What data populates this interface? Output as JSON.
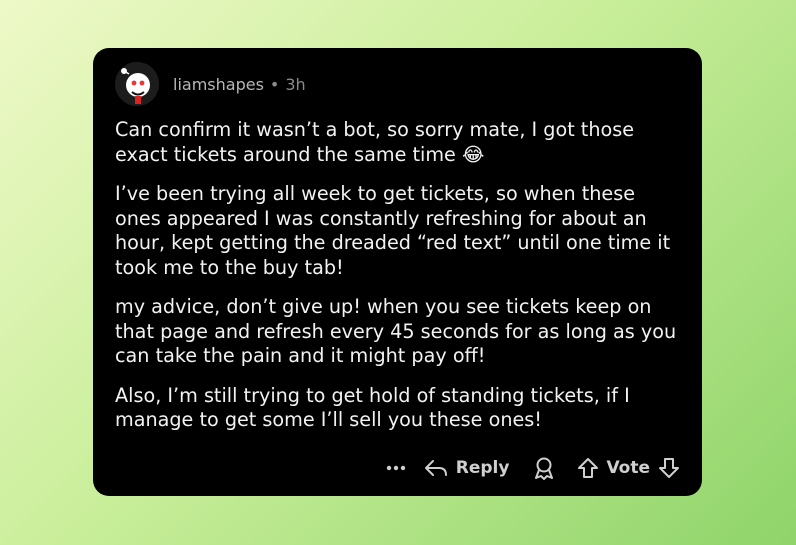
{
  "comment": {
    "username": "liamshapes",
    "separator": "•",
    "time_ago": "3h",
    "paragraphs": [
      "Can confirm it wasn’t a bot, so sorry mate, I got those exact tickets around the same time 😂",
      "I’ve been trying all week to get tickets, so when these ones appeared I was constantly refreshing for about an hour, kept getting the dreaded “red text” until one time it took me to the buy tab!",
      "my advice, don’t give up! when you see tickets keep on that page and refresh every 45 seconds for as long as you can take the pain and it might pay off!",
      "Also, I’m still trying to get hold of standing tickets, if I manage to get some I’ll sell you these ones!"
    ]
  },
  "actions": {
    "more_icon": "more-dots-icon",
    "reply_icon": "reply-arrow-icon",
    "reply_label": "Reply",
    "award_icon": "award-icon",
    "upvote_icon": "upvote-arrow-icon",
    "vote_label": "Vote",
    "downvote_icon": "downvote-arrow-icon"
  }
}
